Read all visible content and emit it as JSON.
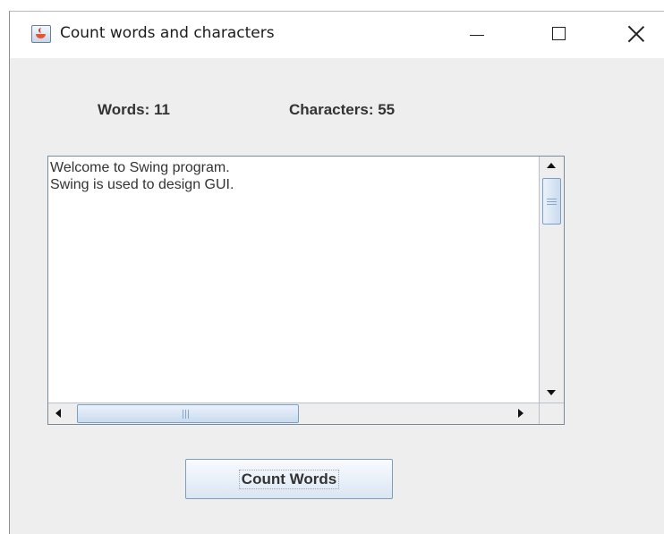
{
  "window": {
    "title": "Count words and characters",
    "icon": "java-cup-icon",
    "controls": [
      "minimize-icon",
      "maximize-icon",
      "close-icon"
    ]
  },
  "labels": {
    "words": "Words: 11",
    "characters": "Characters: 55"
  },
  "text_area": {
    "lines": [
      "Welcome to Swing program.",
      "Swing is used to design GUI."
    ]
  },
  "scrollbars": {
    "vertical": {
      "up_arrow": "arrow-up-icon",
      "down_arrow": "arrow-down-icon"
    },
    "horizontal": {
      "left_arrow": "arrow-left-icon",
      "right_arrow": "arrow-right-icon"
    }
  },
  "button": {
    "count_label": "Count Words"
  },
  "colors": {
    "window_background": "#eeeeee",
    "titlebar_background": "#ffffff",
    "label_text": "#333333",
    "scroll_thumb": "#c9dbee",
    "scroll_thumb_border": "#7d9ec3"
  }
}
